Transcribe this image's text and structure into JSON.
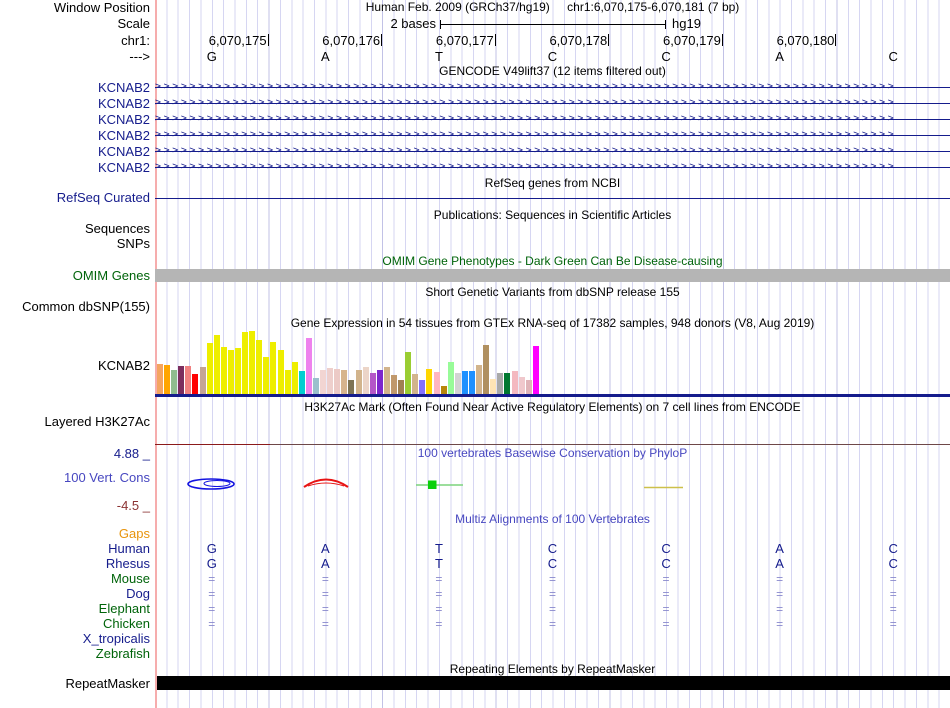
{
  "header": {
    "assembly": "Human Feb. 2009 (GRCh37/hg19)",
    "position": "chr1:6,070,175-6,070,181 (7 bp)",
    "rows": {
      "window_position": "Window Position",
      "scale": "Scale",
      "chrom": "chr1:",
      "strand": "--->"
    },
    "scale": {
      "span_label": "2 bases",
      "assembly": "hg19"
    },
    "coordinates": [
      "6,070,175",
      "6,070,176",
      "6,070,177",
      "6,070,178",
      "6,070,179",
      "6,070,180"
    ],
    "bases": [
      "G",
      "A",
      "T",
      "C",
      "C",
      "A",
      "C"
    ]
  },
  "tracks": {
    "gencode": {
      "title": "GENCODE V49lift37 (12 items filtered out)",
      "gene": "KCNAB2",
      "transcript_count": 6
    },
    "refseq": {
      "title": "RefSeq genes from NCBI",
      "label": "RefSeq Curated"
    },
    "publications": {
      "title": "Publications: Sequences in Scientific Articles",
      "label_sequences": "Sequences",
      "label_snps": "SNPs"
    },
    "omim": {
      "title": "OMIM Gene Phenotypes - Dark Green Can Be Disease-causing",
      "label": "OMIM Genes"
    },
    "dbsnp": {
      "title": "Short Genetic Variants from dbSNP release 155",
      "label": "Common dbSNP(155)"
    },
    "gtex": {
      "title": "Gene Expression in 54 tissues from GTEx RNA-seq of 17382 samples, 948 donors (V8, Aug 2019)",
      "label": "KCNAB2"
    },
    "h3k27ac": {
      "title": "H3K27Ac Mark (Often Found Near Active Regulatory Elements) on 7 cell lines from ENCODE",
      "label": "Layered H3K27Ac"
    },
    "conservation": {
      "title": "100 vertebrates Basewise Conservation by PhyloP",
      "label": "100 Vert. Cons",
      "max": "4.88 _",
      "min": "-4.5 _"
    },
    "multiz": {
      "title": "Multiz Alignments of 100 Vertebrates",
      "rows": [
        {
          "label": "Gaps",
          "color": "orange",
          "cells": [
            "",
            "",
            "",
            "",
            "",
            "",
            ""
          ]
        },
        {
          "label": "Human",
          "color": "navy",
          "cells": [
            "G",
            "A",
            "T",
            "C",
            "C",
            "A",
            "C"
          ]
        },
        {
          "label": "Rhesus",
          "color": "navy",
          "cells": [
            "G",
            "A",
            "T",
            "C",
            "C",
            "A",
            "C"
          ]
        },
        {
          "label": "Mouse",
          "color": "green",
          "cells": [
            "=",
            "=",
            "=",
            "=",
            "=",
            "=",
            "="
          ]
        },
        {
          "label": "Dog",
          "color": "navy",
          "cells": [
            "=",
            "=",
            "=",
            "=",
            "=",
            "=",
            "="
          ]
        },
        {
          "label": "Elephant",
          "color": "green",
          "cells": [
            "=",
            "=",
            "=",
            "=",
            "=",
            "=",
            "="
          ]
        },
        {
          "label": "Chicken",
          "color": "green",
          "cells": [
            "=",
            "=",
            "=",
            "=",
            "=",
            "=",
            "="
          ]
        },
        {
          "label": "X_tropicalis",
          "color": "navy",
          "cells": [
            "",
            "",
            "",
            "",
            "",
            "",
            ""
          ]
        },
        {
          "label": "Zebrafish",
          "color": "green",
          "cells": [
            "",
            "",
            "",
            "",
            "",
            "",
            ""
          ]
        }
      ]
    },
    "repeatmasker": {
      "title": "Repeating Elements by RepeatMasker",
      "label": "RepeatMasker"
    }
  },
  "chart_data": {
    "type": "bar",
    "title": "Gene Expression in 54 tissues from GTEx RNA-seq of 17382 samples, 948 donors (V8, Aug 2019)",
    "gene": "KCNAB2",
    "xlabel": "",
    "ylabel": "",
    "note": "54 GTEx tissue bars; tissue names are not rendered in the image, heights estimated in pixels",
    "bars": [
      [
        "#f4a460",
        30
      ],
      [
        "#ffa500",
        29
      ],
      [
        "#8fbc8f",
        24
      ],
      [
        "#7b2d5e",
        28
      ],
      [
        "#f08080",
        28
      ],
      [
        "#ff0000",
        20
      ],
      [
        "#c4a494",
        27
      ],
      [
        "#eeee00",
        51
      ],
      [
        "#eeee00",
        59
      ],
      [
        "#eeee00",
        47
      ],
      [
        "#eeee00",
        44
      ],
      [
        "#eeee00",
        46
      ],
      [
        "#eeee00",
        62
      ],
      [
        "#eeee00",
        63
      ],
      [
        "#eeee00",
        54
      ],
      [
        "#eeee00",
        37
      ],
      [
        "#eeee00",
        52
      ],
      [
        "#eeee00",
        44
      ],
      [
        "#eeee00",
        24
      ],
      [
        "#eeee00",
        32
      ],
      [
        "#00ced1",
        23
      ],
      [
        "#ee82ee",
        56
      ],
      [
        "#9ac0cd",
        16
      ],
      [
        "#f2d5d2",
        24
      ],
      [
        "#eecfcc",
        26
      ],
      [
        "#eccac6",
        25
      ],
      [
        "#d6b48e",
        24
      ],
      [
        "#7d7354",
        14
      ],
      [
        "#d2b48c",
        24
      ],
      [
        "#ecd5c8",
        27
      ],
      [
        "#b456c8",
        21
      ],
      [
        "#7d26cd",
        24
      ],
      [
        "#d2b48c",
        27
      ],
      [
        "#c0986c",
        19
      ],
      [
        "#a08052",
        14
      ],
      [
        "#9acd32",
        42
      ],
      [
        "#d2b48c",
        20
      ],
      [
        "#8470ff",
        14
      ],
      [
        "#ffd700",
        25
      ],
      [
        "#ffb6c1",
        22
      ],
      [
        "#b8860b",
        8
      ],
      [
        "#98fb98",
        32
      ],
      [
        "#d3d3d3",
        21
      ],
      [
        "#1e90ff",
        23
      ],
      [
        "#1e90ff",
        23
      ],
      [
        "#d2b48c",
        29
      ],
      [
        "#b09060",
        49
      ],
      [
        "#ffe4b5",
        15
      ],
      [
        "#a9a9a9",
        21
      ],
      [
        "#007830",
        21
      ],
      [
        "#f4b8c0",
        23
      ],
      [
        "#f0c8cc",
        17
      ],
      [
        "#e0b4b8",
        14
      ],
      [
        "#ff00ff",
        48
      ]
    ]
  },
  "colors": {
    "navy": "#151c8c",
    "blue": "#4747c0",
    "green": "#00640a",
    "orange": "#e8940c",
    "maroon": "#8b3232",
    "grid": "#d6d6f2",
    "guideline": "#f6adad",
    "omim_bar": "#b5b5b5",
    "repeat_bar": "#000000",
    "gtex_baseline": "#151c8c",
    "h3k27ac_line": "#7a2828",
    "align_mark": "#8888cc",
    "phylop_pos": "#1414e0",
    "phylop_neg": "#e81414",
    "phylop_green": "#0ad00a",
    "phylop_yellow": "#cdc04a"
  }
}
